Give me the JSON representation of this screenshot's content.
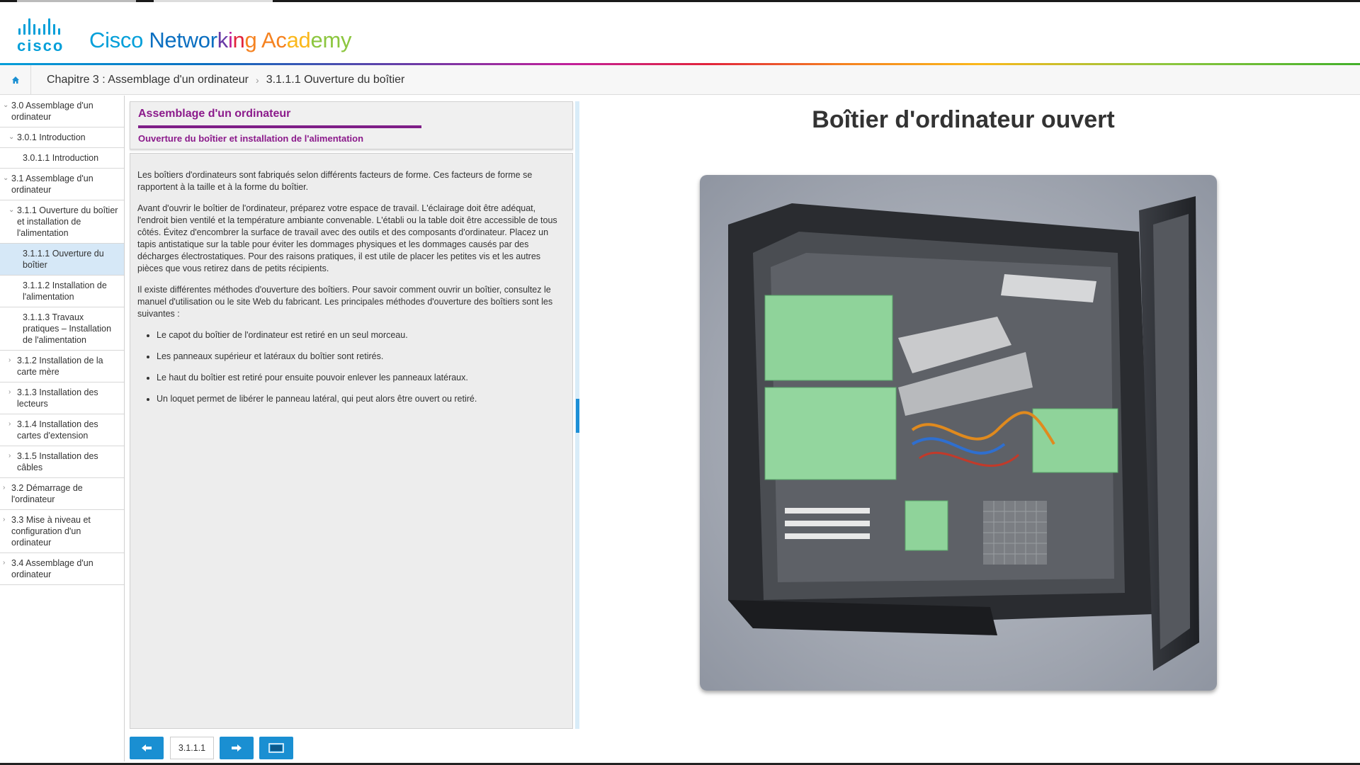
{
  "header": {
    "logo_text": "cisco",
    "brand_segments": [
      {
        "text": "Cisco ",
        "color": "#049fd9"
      },
      {
        "text": "Networ",
        "color": "#0b6fc1"
      },
      {
        "text": "k",
        "color": "#6a3ca7"
      },
      {
        "text": "i",
        "color": "#c2209a"
      },
      {
        "text": "n",
        "color": "#e2233c"
      },
      {
        "text": "g ",
        "color": "#f58220"
      },
      {
        "text": "Ac",
        "color": "#f58220"
      },
      {
        "text": "ad",
        "color": "#fbb81b"
      },
      {
        "text": "emy",
        "color": "#8cc63f"
      }
    ]
  },
  "breadcrumb": {
    "home_icon": "home-icon",
    "chapter": "Chapitre 3 : Assemblage d'un ordinateur",
    "page": "3.1.1.1 Ouverture du boîtier"
  },
  "sidebar": {
    "items": [
      {
        "label": "3.0 Assemblage d'un ordinateur",
        "level": 0,
        "chevron": "down"
      },
      {
        "label": "3.0.1 Introduction",
        "level": 1,
        "chevron": "down"
      },
      {
        "label": "3.0.1.1 Introduction",
        "level": 2,
        "chevron": ""
      },
      {
        "label": "3.1 Assemblage d'un ordinateur",
        "level": 0,
        "chevron": "down"
      },
      {
        "label": "3.1.1 Ouverture du boîtier et installation de l'alimentation",
        "level": 1,
        "chevron": "down"
      },
      {
        "label": "3.1.1.1 Ouverture du boîtier",
        "level": 2,
        "chevron": "",
        "active": true
      },
      {
        "label": "3.1.1.2 Installation de l'alimentation",
        "level": 2,
        "chevron": ""
      },
      {
        "label": "3.1.1.3 Travaux pratiques – Installation de l'alimentation",
        "level": 2,
        "chevron": ""
      },
      {
        "label": "3.1.2 Installation de la carte mère",
        "level": 1,
        "chevron": "right"
      },
      {
        "label": "3.1.3 Installation des lecteurs",
        "level": 1,
        "chevron": "right"
      },
      {
        "label": "3.1.4 Installation des cartes d'extension",
        "level": 1,
        "chevron": "right"
      },
      {
        "label": "3.1.5 Installation des câbles",
        "level": 1,
        "chevron": "right"
      },
      {
        "label": "3.2 Démarrage de l'ordinateur",
        "level": 0,
        "chevron": "right"
      },
      {
        "label": "3.3 Mise à niveau et configuration d'un ordinateur",
        "level": 0,
        "chevron": "right"
      },
      {
        "label": "3.4 Assemblage d'un ordinateur",
        "level": 0,
        "chevron": "right"
      }
    ]
  },
  "content": {
    "title": "Assemblage d'un ordinateur",
    "subtitle": "Ouverture du boîtier et installation de l'alimentation",
    "paragraphs": [
      "Les boîtiers d'ordinateurs sont fabriqués selon différents facteurs de forme. Ces facteurs de forme se rapportent à la taille et à la forme du boîtier.",
      "Avant d'ouvrir le boîtier de l'ordinateur, préparez votre espace de travail. L'éclairage doit être adéquat, l'endroit bien ventilé et la température ambiante convenable. L'établi ou la table doit être accessible de tous côtés. Évitez d'encombrer la surface de travail avec des outils et des composants d'ordinateur. Placez un tapis antistatique sur la table pour éviter les dommages physiques et les dommages causés par des décharges électrostatiques. Pour des raisons pratiques, il est utile de placer les petites vis et les autres pièces que vous retirez dans de petits récipients.",
      "Il existe différentes méthodes d'ouverture des boîtiers. Pour savoir comment ouvrir un boîtier, consultez le manuel d'utilisation ou le site Web du fabricant. Les principales méthodes d'ouverture des boîtiers sont les suivantes :"
    ],
    "bullets": [
      "Le capot du boîtier de l'ordinateur est retiré en un seul morceau.",
      "Les panneaux supérieur et latéraux du boîtier sont retirés.",
      "Le haut du boîtier est retiré pour ensuite pouvoir enlever les panneaux latéraux.",
      "Un loquet permet de libérer le panneau latéral, qui peut alors être ouvert ou retiré."
    ]
  },
  "navigation": {
    "prev_icon": "arrow-left-icon",
    "page_number": "3.1.1.1",
    "next_icon": "arrow-right-icon",
    "fullscreen_icon": "fullscreen-icon"
  },
  "media": {
    "title": "Boîtier d'ordinateur ouvert"
  },
  "colors": {
    "accent": "#1a8fd2",
    "title_purple": "#8b1a8b",
    "active_item": "#d6e8f7"
  }
}
